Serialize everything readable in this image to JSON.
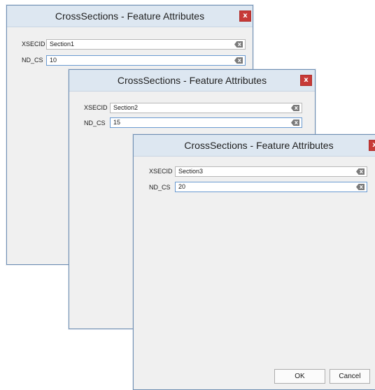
{
  "dialogs": [
    {
      "title": "CrossSections - Feature Attributes",
      "close_label": "x",
      "fields": [
        {
          "label": "XSECID",
          "value": "Section1"
        },
        {
          "label": "ND_CS",
          "value": "10"
        }
      ]
    },
    {
      "title": "CrossSections - Feature Attributes",
      "close_label": "x",
      "fields": [
        {
          "label": "XSECID",
          "value": "Section2"
        },
        {
          "label": "ND_CS",
          "value": "15"
        }
      ]
    },
    {
      "title": "CrossSections - Feature Attributes",
      "close_label": "x",
      "fields": [
        {
          "label": "XSECID",
          "value": "Section3"
        },
        {
          "label": "ND_CS",
          "value": "20"
        }
      ],
      "buttons": {
        "ok": "OK",
        "cancel": "Cancel"
      }
    }
  ]
}
